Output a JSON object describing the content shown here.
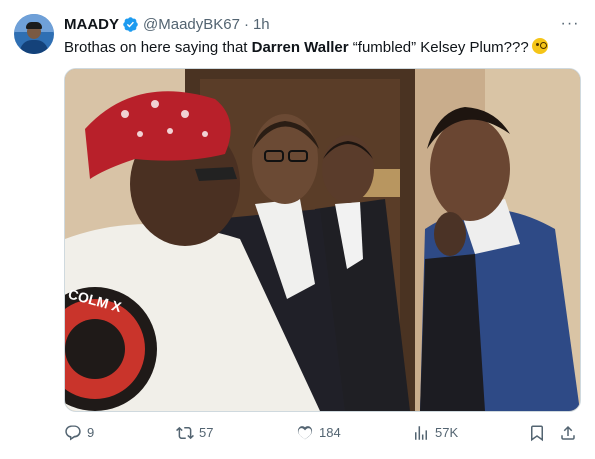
{
  "tweet": {
    "author_name": "MAADY",
    "handle": "@MaadyBK67",
    "separator": "·",
    "time": "1h",
    "more_label": "···",
    "text_before": "Brothas on here saying that ",
    "text_bold": "Darren Waller",
    "text_after": " “fumbled” Kelsey Plum???",
    "emoji": "face-with-monocle",
    "verified_color": "#1d9bf0"
  },
  "actions": {
    "replies": "9",
    "reposts": "57",
    "likes": "184",
    "views": "57K"
  },
  "colors": {
    "text": "#0f1419",
    "muted": "#536471",
    "border": "#cfd9de"
  },
  "icons": [
    "reply-icon",
    "repost-icon",
    "like-icon",
    "views-icon",
    "bookmark-icon",
    "share-icon",
    "verified-badge-icon",
    "more-icon"
  ]
}
